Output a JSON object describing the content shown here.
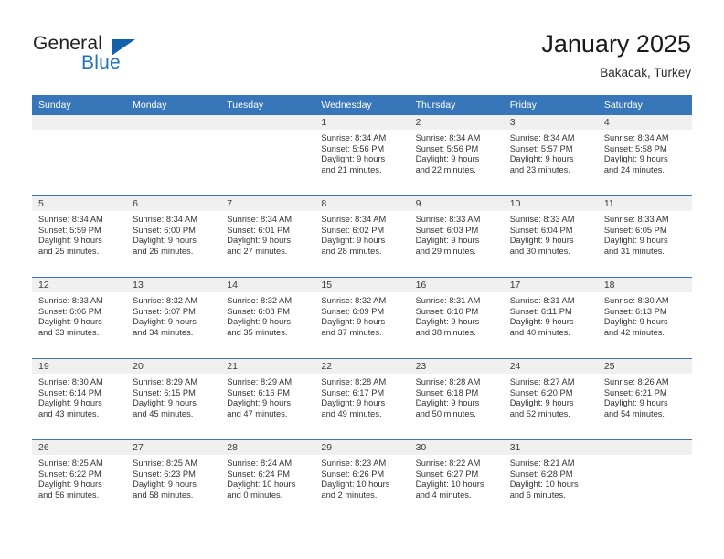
{
  "brand": {
    "name_part1": "General",
    "name_part2": "Blue",
    "logo_icon": "triangle-flag-icon",
    "accent_color": "#1c72bb"
  },
  "header": {
    "title": "January 2025",
    "subtitle": "Bakacak, Turkey"
  },
  "calendar": {
    "header_bg": "#3777b9",
    "daynum_bg": "#f0f0f0",
    "weekday_headers": [
      "Sunday",
      "Monday",
      "Tuesday",
      "Wednesday",
      "Thursday",
      "Friday",
      "Saturday"
    ],
    "weeks": [
      [
        {
          "day": ""
        },
        {
          "day": ""
        },
        {
          "day": ""
        },
        {
          "day": "1",
          "sunrise": "Sunrise: 8:34 AM",
          "sunset": "Sunset: 5:56 PM",
          "daylight_line1": "Daylight: 9 hours",
          "daylight_line2": "and 21 minutes."
        },
        {
          "day": "2",
          "sunrise": "Sunrise: 8:34 AM",
          "sunset": "Sunset: 5:56 PM",
          "daylight_line1": "Daylight: 9 hours",
          "daylight_line2": "and 22 minutes."
        },
        {
          "day": "3",
          "sunrise": "Sunrise: 8:34 AM",
          "sunset": "Sunset: 5:57 PM",
          "daylight_line1": "Daylight: 9 hours",
          "daylight_line2": "and 23 minutes."
        },
        {
          "day": "4",
          "sunrise": "Sunrise: 8:34 AM",
          "sunset": "Sunset: 5:58 PM",
          "daylight_line1": "Daylight: 9 hours",
          "daylight_line2": "and 24 minutes."
        }
      ],
      [
        {
          "day": "5",
          "sunrise": "Sunrise: 8:34 AM",
          "sunset": "Sunset: 5:59 PM",
          "daylight_line1": "Daylight: 9 hours",
          "daylight_line2": "and 25 minutes."
        },
        {
          "day": "6",
          "sunrise": "Sunrise: 8:34 AM",
          "sunset": "Sunset: 6:00 PM",
          "daylight_line1": "Daylight: 9 hours",
          "daylight_line2": "and 26 minutes."
        },
        {
          "day": "7",
          "sunrise": "Sunrise: 8:34 AM",
          "sunset": "Sunset: 6:01 PM",
          "daylight_line1": "Daylight: 9 hours",
          "daylight_line2": "and 27 minutes."
        },
        {
          "day": "8",
          "sunrise": "Sunrise: 8:34 AM",
          "sunset": "Sunset: 6:02 PM",
          "daylight_line1": "Daylight: 9 hours",
          "daylight_line2": "and 28 minutes."
        },
        {
          "day": "9",
          "sunrise": "Sunrise: 8:33 AM",
          "sunset": "Sunset: 6:03 PM",
          "daylight_line1": "Daylight: 9 hours",
          "daylight_line2": "and 29 minutes."
        },
        {
          "day": "10",
          "sunrise": "Sunrise: 8:33 AM",
          "sunset": "Sunset: 6:04 PM",
          "daylight_line1": "Daylight: 9 hours",
          "daylight_line2": "and 30 minutes."
        },
        {
          "day": "11",
          "sunrise": "Sunrise: 8:33 AM",
          "sunset": "Sunset: 6:05 PM",
          "daylight_line1": "Daylight: 9 hours",
          "daylight_line2": "and 31 minutes."
        }
      ],
      [
        {
          "day": "12",
          "sunrise": "Sunrise: 8:33 AM",
          "sunset": "Sunset: 6:06 PM",
          "daylight_line1": "Daylight: 9 hours",
          "daylight_line2": "and 33 minutes."
        },
        {
          "day": "13",
          "sunrise": "Sunrise: 8:32 AM",
          "sunset": "Sunset: 6:07 PM",
          "daylight_line1": "Daylight: 9 hours",
          "daylight_line2": "and 34 minutes."
        },
        {
          "day": "14",
          "sunrise": "Sunrise: 8:32 AM",
          "sunset": "Sunset: 6:08 PM",
          "daylight_line1": "Daylight: 9 hours",
          "daylight_line2": "and 35 minutes."
        },
        {
          "day": "15",
          "sunrise": "Sunrise: 8:32 AM",
          "sunset": "Sunset: 6:09 PM",
          "daylight_line1": "Daylight: 9 hours",
          "daylight_line2": "and 37 minutes."
        },
        {
          "day": "16",
          "sunrise": "Sunrise: 8:31 AM",
          "sunset": "Sunset: 6:10 PM",
          "daylight_line1": "Daylight: 9 hours",
          "daylight_line2": "and 38 minutes."
        },
        {
          "day": "17",
          "sunrise": "Sunrise: 8:31 AM",
          "sunset": "Sunset: 6:11 PM",
          "daylight_line1": "Daylight: 9 hours",
          "daylight_line2": "and 40 minutes."
        },
        {
          "day": "18",
          "sunrise": "Sunrise: 8:30 AM",
          "sunset": "Sunset: 6:13 PM",
          "daylight_line1": "Daylight: 9 hours",
          "daylight_line2": "and 42 minutes."
        }
      ],
      [
        {
          "day": "19",
          "sunrise": "Sunrise: 8:30 AM",
          "sunset": "Sunset: 6:14 PM",
          "daylight_line1": "Daylight: 9 hours",
          "daylight_line2": "and 43 minutes."
        },
        {
          "day": "20",
          "sunrise": "Sunrise: 8:29 AM",
          "sunset": "Sunset: 6:15 PM",
          "daylight_line1": "Daylight: 9 hours",
          "daylight_line2": "and 45 minutes."
        },
        {
          "day": "21",
          "sunrise": "Sunrise: 8:29 AM",
          "sunset": "Sunset: 6:16 PM",
          "daylight_line1": "Daylight: 9 hours",
          "daylight_line2": "and 47 minutes."
        },
        {
          "day": "22",
          "sunrise": "Sunrise: 8:28 AM",
          "sunset": "Sunset: 6:17 PM",
          "daylight_line1": "Daylight: 9 hours",
          "daylight_line2": "and 49 minutes."
        },
        {
          "day": "23",
          "sunrise": "Sunrise: 8:28 AM",
          "sunset": "Sunset: 6:18 PM",
          "daylight_line1": "Daylight: 9 hours",
          "daylight_line2": "and 50 minutes."
        },
        {
          "day": "24",
          "sunrise": "Sunrise: 8:27 AM",
          "sunset": "Sunset: 6:20 PM",
          "daylight_line1": "Daylight: 9 hours",
          "daylight_line2": "and 52 minutes."
        },
        {
          "day": "25",
          "sunrise": "Sunrise: 8:26 AM",
          "sunset": "Sunset: 6:21 PM",
          "daylight_line1": "Daylight: 9 hours",
          "daylight_line2": "and 54 minutes."
        }
      ],
      [
        {
          "day": "26",
          "sunrise": "Sunrise: 8:25 AM",
          "sunset": "Sunset: 6:22 PM",
          "daylight_line1": "Daylight: 9 hours",
          "daylight_line2": "and 56 minutes."
        },
        {
          "day": "27",
          "sunrise": "Sunrise: 8:25 AM",
          "sunset": "Sunset: 6:23 PM",
          "daylight_line1": "Daylight: 9 hours",
          "daylight_line2": "and 58 minutes."
        },
        {
          "day": "28",
          "sunrise": "Sunrise: 8:24 AM",
          "sunset": "Sunset: 6:24 PM",
          "daylight_line1": "Daylight: 10 hours",
          "daylight_line2": "and 0 minutes."
        },
        {
          "day": "29",
          "sunrise": "Sunrise: 8:23 AM",
          "sunset": "Sunset: 6:26 PM",
          "daylight_line1": "Daylight: 10 hours",
          "daylight_line2": "and 2 minutes."
        },
        {
          "day": "30",
          "sunrise": "Sunrise: 8:22 AM",
          "sunset": "Sunset: 6:27 PM",
          "daylight_line1": "Daylight: 10 hours",
          "daylight_line2": "and 4 minutes."
        },
        {
          "day": "31",
          "sunrise": "Sunrise: 8:21 AM",
          "sunset": "Sunset: 6:28 PM",
          "daylight_line1": "Daylight: 10 hours",
          "daylight_line2": "and 6 minutes."
        },
        {
          "day": ""
        }
      ]
    ]
  }
}
